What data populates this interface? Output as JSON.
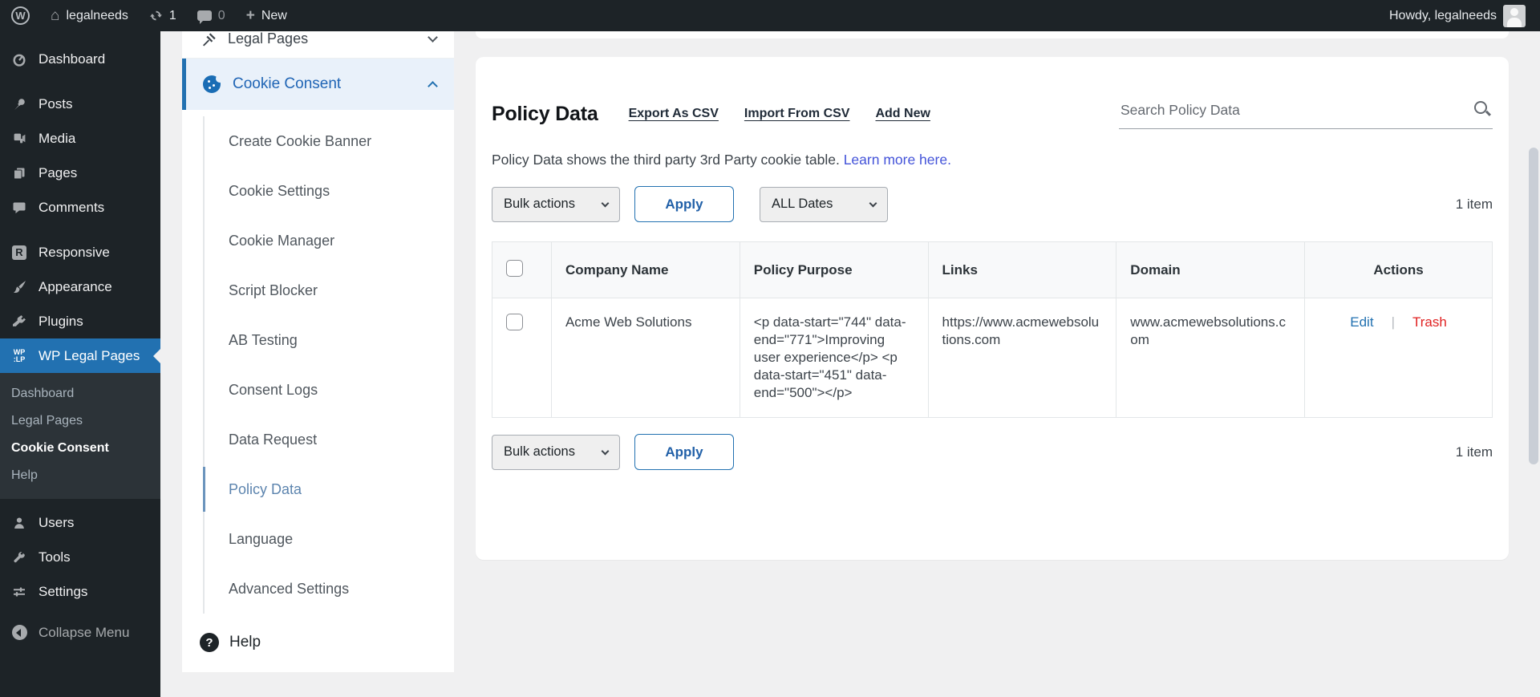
{
  "admin_bar": {
    "site_name": "legalneeds",
    "updates_count": "1",
    "comments_count": "0",
    "new_label": "New",
    "howdy": "Howdy, legalneeds"
  },
  "icons": {
    "wordpress": "W",
    "home": "⌂",
    "responsive_letter": "R",
    "wplp_line1": "WP",
    "wplp_line2": ":LP",
    "help_mark": "?",
    "plus": "+",
    "pipe": "|"
  },
  "sidebar": {
    "items": [
      {
        "label": "Dashboard"
      },
      {
        "label": "Posts"
      },
      {
        "label": "Media"
      },
      {
        "label": "Pages"
      },
      {
        "label": "Comments"
      },
      {
        "label": "Responsive"
      },
      {
        "label": "Appearance"
      },
      {
        "label": "Plugins"
      },
      {
        "label": "WP Legal Pages"
      }
    ],
    "active_item": "WP Legal Pages",
    "submenu": [
      "Dashboard",
      "Legal Pages",
      "Cookie Consent",
      "Help"
    ],
    "submenu_active": "Cookie Consent",
    "bottom_items": [
      {
        "label": "Users"
      },
      {
        "label": "Tools"
      },
      {
        "label": "Settings"
      }
    ],
    "collapse_label": "Collapse Menu"
  },
  "panel": {
    "parent_item": "Legal Pages",
    "active_item": "Cookie Consent",
    "sub_items": [
      "Create Cookie Banner",
      "Cookie Settings",
      "Cookie Manager",
      "Script Blocker",
      "AB Testing",
      "Consent Logs",
      "Data Request",
      "Policy Data",
      "Language",
      "Advanced Settings"
    ],
    "active_sub_item": "Policy Data",
    "help_label": "Help"
  },
  "main": {
    "title": "Policy Data",
    "action_links": [
      "Export As CSV",
      "Import From CSV",
      "Add New"
    ],
    "search_placeholder": "Search Policy Data",
    "description": "Policy Data shows the third party 3rd Party cookie table.",
    "learn_more_link": "Learn more here.",
    "bulk_actions_label": "Bulk actions",
    "apply_label": "Apply",
    "dates_filter_label": "ALL Dates",
    "items_count": "1 item",
    "table": {
      "headers": [
        "Company Name",
        "Policy Purpose",
        "Links",
        "Domain",
        "Actions"
      ],
      "rows": [
        {
          "company_name": "Acme Web Solutions",
          "policy_purpose": "<p data-start=\"744\" data-end=\"771\">Improving user experience</p> <p data-start=\"451\" data-end=\"500\"></p>",
          "links": "https://www.acmewebsolutions.com",
          "domain": "www.acmewebsolutions.com",
          "edit_label": "Edit",
          "trash_label": "Trash"
        }
      ]
    }
  },
  "colors": {
    "accent_blue": "#2271b1",
    "sidebar_bg": "#1d2327",
    "submenu_bg": "#2c3338",
    "page_bg": "#f0f0f1",
    "active_row_bg": "#e9f1fa",
    "edit_link": "#2271b1",
    "trash_link": "#e02222",
    "learn_more_link": "#4353d9",
    "active_sub_item_text": "#5c84ae"
  }
}
